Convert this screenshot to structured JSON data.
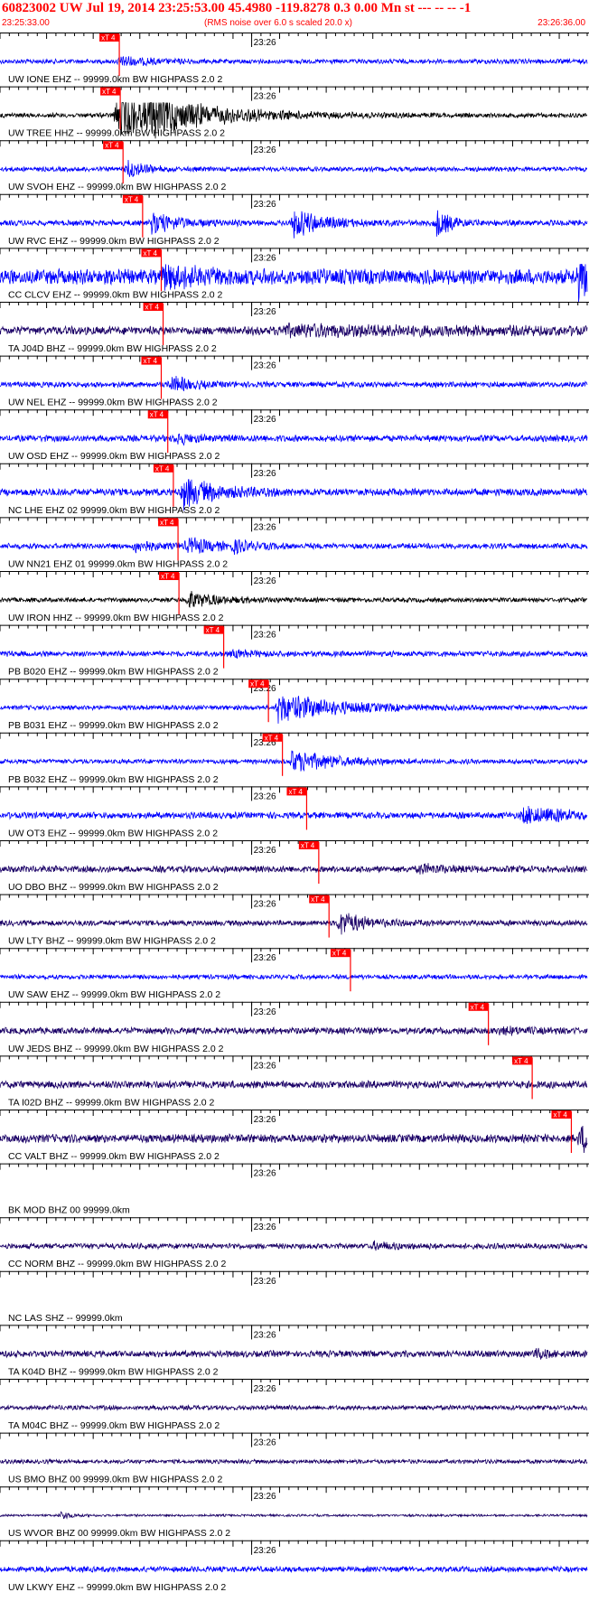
{
  "header": {
    "title": "60823002 UW Jul 19, 2014 23:25:53.00   45.4980 -119.8278  0.3 0.00 Mn st --- -- --   -1",
    "start_time": "23:25:33.00",
    "noise_note": "(RMS noise over 6.0 s scaled 20.0 x)",
    "end_time": "23:26:36.00"
  },
  "colors": {
    "header_text": "#ff0000",
    "pick": "#ff0000",
    "blue_trace": "#0000ff",
    "navy_trace": "#1a0066",
    "black_trace": "#000000"
  },
  "chart_data": {
    "type": "line",
    "title": "60823002 UW Jul 19, 2014 23:25:53.00   45.4980 -119.8278  0.3 0.00 Mn st --- -- --   -1",
    "x_range": [
      "23:25:33.00",
      "23:26:36.00"
    ],
    "minute_tick_label": "23:26",
    "minute_tick_time": "23:26:00",
    "pick_label": "xT 4",
    "traces": [
      {
        "label": "UW IONE EHZ -- 99999.0km BW  HIGHPASS  2.0  2",
        "color": "blue",
        "pick_time": "23:25:45.8",
        "amp": 0.25,
        "events": [
          [
            12.9,
            0.55,
            3
          ]
        ]
      },
      {
        "label": "UW TREE HHZ -- 99999.0km BW  HIGHPASS  2.0  2",
        "color": "black",
        "pick_time": "23:25:45.9",
        "amp": 0.25,
        "events": [
          [
            12.5,
            2.6,
            7
          ],
          [
            16,
            0.9,
            6
          ]
        ]
      },
      {
        "label": "UW SVOH EHZ -- 99999.0km BW  HIGHPASS  2.0  2",
        "color": "blue",
        "pick_time": "23:25:46.2",
        "amp": 0.25,
        "events": [
          [
            13.7,
            0.9,
            2
          ]
        ]
      },
      {
        "label": "UW RVC EHZ -- 99999.0km BW  HIGHPASS  2.0  2",
        "color": "blue",
        "pick_time": "23:25:48.3",
        "amp": 0.3,
        "events": [
          [
            16.2,
            1.0,
            3
          ],
          [
            31.5,
            1.4,
            3
          ],
          [
            46.8,
            1.6,
            1.5
          ]
        ]
      },
      {
        "label": "CC CLCV EHZ -- 99999.0km BW  HIGHPASS  2.0  2",
        "color": "blue",
        "pick_time": "23:25:50.3",
        "amp": 0.8,
        "events": [
          [
            17.6,
            1.1,
            4
          ],
          [
            62,
            2.4,
            3
          ]
        ]
      },
      {
        "label": "TA J04D BHZ -- 99999.0km BW  HIGHPASS  2.0  2",
        "color": "navy",
        "pick_time": "23:25:50.5",
        "amp": 0.45,
        "events": [
          [
            30,
            0.4,
            25
          ]
        ]
      },
      {
        "label": "UW NEL EHZ -- 99999.0km BW  HIGHPASS  2.0  2",
        "color": "blue",
        "pick_time": "23:25:50.3",
        "amp": 0.3,
        "events": [
          [
            18.3,
            0.9,
            2
          ]
        ]
      },
      {
        "label": "UW OSD EHZ -- 99999.0km BW  HIGHPASS  2.0  2",
        "color": "blue",
        "pick_time": "23:25:51.0",
        "amp": 0.35,
        "events": [
          [
            19,
            0.5,
            2
          ]
        ]
      },
      {
        "label": "NC LHE EHZ 02 99999.0km BW  HIGHPASS  2.0  2",
        "color": "blue",
        "pick_time": "23:25:51.6",
        "amp": 0.4,
        "events": [
          [
            19.6,
            1.8,
            3
          ]
        ]
      },
      {
        "label": "UW NN21 EHZ 01 99999.0km BW  HIGHPASS  2.0  2",
        "color": "blue",
        "pick_time": "23:25:52.1",
        "amp": 0.3,
        "events": [
          [
            14.5,
            0.6,
            2
          ],
          [
            20.1,
            0.8,
            3
          ],
          [
            25,
            0.5,
            2
          ]
        ]
      },
      {
        "label": "UW IRON HHZ -- 99999.0km BW  HIGHPASS  2.0  2",
        "color": "black",
        "pick_time": "23:25:52.2",
        "amp": 0.25,
        "events": [
          [
            20.2,
            0.9,
            3
          ]
        ]
      },
      {
        "label": "PB B020 EHZ -- 99999.0km BW  HIGHPASS  2.0  2",
        "color": "blue",
        "pick_time": "23:25:57.0",
        "amp": 0.3,
        "events": [
          [
            25,
            0.3,
            2
          ]
        ]
      },
      {
        "label": "PB B031 EHZ -- 99999.0km BW  HIGHPASS  2.0  2",
        "color": "blue",
        "pick_time": "23:26:01.8",
        "amp": 0.25,
        "events": [
          [
            29.8,
            1.5,
            6
          ]
        ]
      },
      {
        "label": "PB B032 EHZ -- 99999.0km BW  HIGHPASS  2.0  2",
        "color": "blue",
        "pick_time": "23:26:03.3",
        "amp": 0.25,
        "events": [
          [
            31.3,
            1.1,
            5
          ]
        ]
      },
      {
        "label": "UW OT3 EHZ -- 99999.0km BW  HIGHPASS  2.0  2",
        "color": "blue",
        "pick_time": "23:26:05.9",
        "amp": 0.35,
        "events": [
          [
            56,
            0.8,
            6
          ]
        ]
      },
      {
        "label": "UO DBO BHZ -- 99999.0km BW  HIGHPASS  2.0  2",
        "color": "navy",
        "pick_time": "23:26:07.2",
        "amp": 0.35,
        "events": [
          [
            45,
            0.4,
            3
          ]
        ]
      },
      {
        "label": "UW LTY BHZ -- 99999.0km BW  HIGHPASS  2.0  2",
        "color": "navy",
        "pick_time": "23:26:08.3",
        "amp": 0.3,
        "events": [
          [
            36.3,
            1.3,
            2.5
          ]
        ]
      },
      {
        "label": "UW SAW EHZ -- 99999.0km BW  HIGHPASS  2.0  2",
        "color": "blue",
        "pick_time": "23:26:10.6",
        "amp": 0.25,
        "events": []
      },
      {
        "label": "UW JEDS BHZ -- 99999.0km BW  HIGHPASS  2.0  2",
        "color": "navy",
        "pick_time": "23:26:25.4",
        "amp": 0.35,
        "events": [
          [
            53.5,
            0.3,
            3
          ]
        ]
      },
      {
        "label": "TA I02D BHZ -- 99999.0km BW  HIGHPASS  2.0  2",
        "color": "navy",
        "pick_time": "23:26:30.1",
        "amp": 0.4,
        "events": []
      },
      {
        "label": "CC VALT BHZ -- 99999.0km BW  HIGHPASS  2.0  2",
        "color": "navy",
        "pick_time": "23:26:34.3",
        "amp": 0.45,
        "events": [
          [
            62.3,
            1.4,
            2
          ]
        ]
      },
      {
        "label": "BK MOD BHZ 00 99999.0km",
        "color": "none",
        "pick_time": null,
        "amp": 0,
        "events": []
      },
      {
        "label": "CC NORM BHZ -- 99999.0km BW  HIGHPASS  2.0  2",
        "color": "navy",
        "pick_time": null,
        "amp": 0.3,
        "events": [
          [
            40,
            0.3,
            3
          ]
        ]
      },
      {
        "label": "NC LAS SHZ -- 99999.0km",
        "color": "none",
        "pick_time": null,
        "amp": 0,
        "events": []
      },
      {
        "label": "TA K04D BHZ -- 99999.0km BW  HIGHPASS  2.0  2",
        "color": "navy",
        "pick_time": null,
        "amp": 0.35,
        "events": [
          [
            57.5,
            0.6,
            1
          ]
        ]
      },
      {
        "label": "TA M04C BHZ -- 99999.0km BW  HIGHPASS  2.0  2",
        "color": "navy",
        "pick_time": null,
        "amp": 0.25,
        "events": []
      },
      {
        "label": "US BMO BHZ 00 99999.0km BW  HIGHPASS  2.0  2",
        "color": "navy",
        "pick_time": null,
        "amp": 0.22,
        "events": []
      },
      {
        "label": "US WVOR BHZ 00 99999.0km BW  HIGHPASS  2.0  2",
        "color": "navy",
        "pick_time": null,
        "amp": 0.12,
        "events": [
          [
            6.5,
            0.5,
            1
          ]
        ]
      },
      {
        "label": "UW LKWY EHZ -- 99999.0km BW  HIGHPASS  2.0  2",
        "color": "blue",
        "pick_time": null,
        "amp": 0.3,
        "events": []
      }
    ]
  }
}
